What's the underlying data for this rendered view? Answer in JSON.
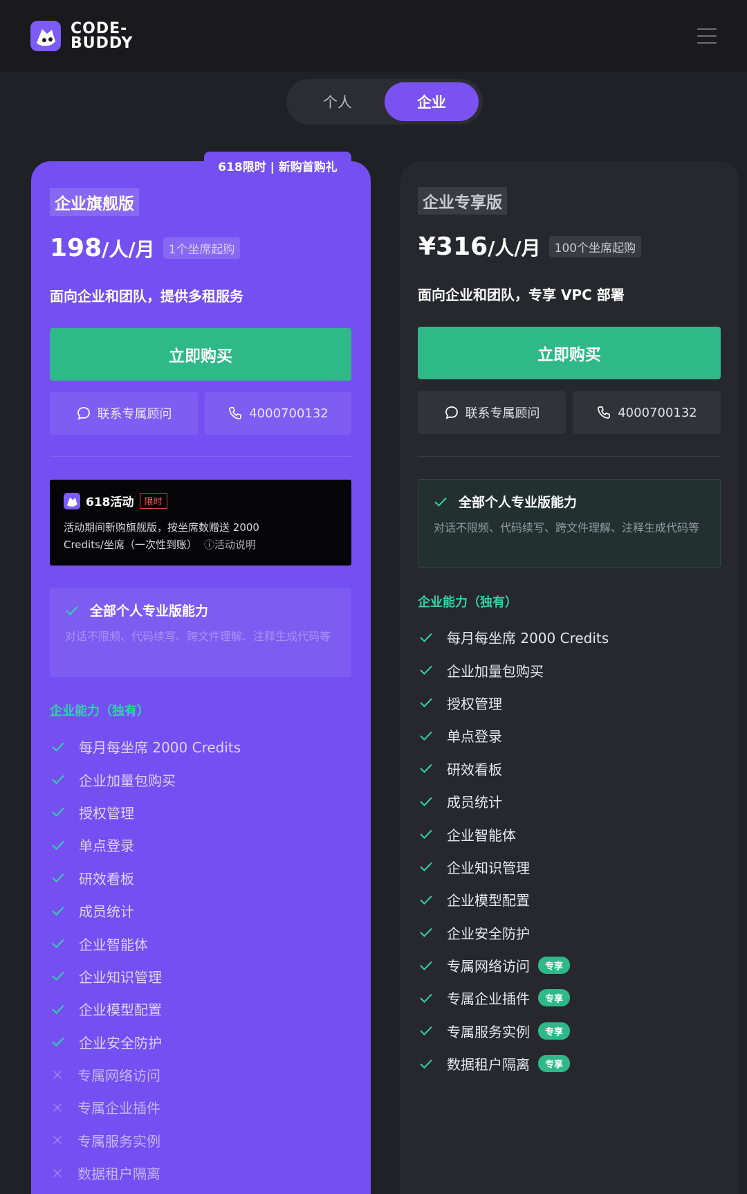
{
  "header": {
    "logo_text_line1": "CODE-",
    "logo_text_line2": "BUDDY",
    "menu_icon": "hamburger-menu-icon"
  },
  "toggle": {
    "personal": "个人",
    "enterprise": "企业",
    "active": "enterprise"
  },
  "colors": {
    "accent_purple": "#7450f2",
    "accent_green": "#2fb888",
    "label_teal": "#2fd4a5",
    "limit_red": "#ff5a5f"
  },
  "left": {
    "promo_tag": "618限时 | 新购首购礼",
    "plan_name": "企业旗舰版",
    "price_amount": "198",
    "price_unit": "/人/月",
    "seat_badge": "1个坐席起购",
    "description": "面向企业和团队，提供多租服务",
    "buy_label": "立即购买",
    "consult_label": "联系专属顾问",
    "phone_label": "4000700132",
    "event": {
      "title": "618活动",
      "limit_badge": "限时",
      "line1": "活动期间新购旗舰版，按坐席数赠送 2000",
      "line2": "Credits/坐席（一次性到账）",
      "info_link": "ⓘ活动说明"
    },
    "feature_box": {
      "title": "全部个人专业版能力",
      "sub": "对话不限频、代码续写、跨文件理解、注释生成代码等"
    },
    "section_label": "企业能力（独有）",
    "features": [
      {
        "text": "每月每坐席 2000 Credits",
        "included": true
      },
      {
        "text": "企业加量包购买",
        "included": true
      },
      {
        "text": "授权管理",
        "included": true
      },
      {
        "text": "单点登录",
        "included": true
      },
      {
        "text": "研效看板",
        "included": true
      },
      {
        "text": "成员统计",
        "included": true
      },
      {
        "text": "企业智能体",
        "included": true
      },
      {
        "text": "企业知识管理",
        "included": true
      },
      {
        "text": "企业模型配置",
        "included": true
      },
      {
        "text": "企业安全防护",
        "included": true
      },
      {
        "text": "专属网络访问",
        "included": false
      },
      {
        "text": "专属企业插件",
        "included": false
      },
      {
        "text": "专属服务实例",
        "included": false
      },
      {
        "text": "数据租户隔离",
        "included": false
      }
    ]
  },
  "right": {
    "plan_name": "企业专享版",
    "price_amount": "¥316",
    "price_unit": "/人/月",
    "seat_badge": "100个坐席起购",
    "description": "面向企业和团队，专享 VPC 部署",
    "buy_label": "立即购买",
    "consult_label": "联系专属顾问",
    "phone_label": "4000700132",
    "feature_box": {
      "title": "全部个人专业版能力",
      "sub": "对话不限频、代码续写、跨文件理解、注释生成代码等"
    },
    "section_label": "企业能力（独有）",
    "exclusive_badge": "专享",
    "features": [
      {
        "text": "每月每坐席 2000 Credits",
        "exclusive": false
      },
      {
        "text": "企业加量包购买",
        "exclusive": false
      },
      {
        "text": "授权管理",
        "exclusive": false
      },
      {
        "text": "单点登录",
        "exclusive": false
      },
      {
        "text": "研效看板",
        "exclusive": false
      },
      {
        "text": "成员统计",
        "exclusive": false
      },
      {
        "text": "企业智能体",
        "exclusive": false
      },
      {
        "text": "企业知识管理",
        "exclusive": false
      },
      {
        "text": "企业模型配置",
        "exclusive": false
      },
      {
        "text": "企业安全防护",
        "exclusive": false
      },
      {
        "text": "专属网络访问",
        "exclusive": true
      },
      {
        "text": "专属企业插件",
        "exclusive": true
      },
      {
        "text": "专属服务实例",
        "exclusive": true
      },
      {
        "text": "数据租户隔离",
        "exclusive": true
      }
    ]
  }
}
